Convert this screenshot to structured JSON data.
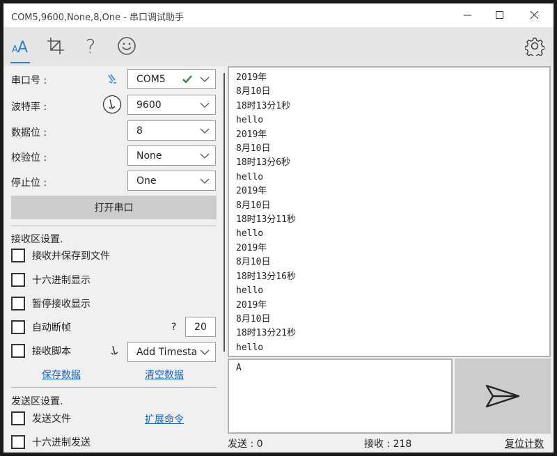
{
  "window": {
    "title": "COM5,9600,None,8,One - 串口调试助手",
    "minimize": "—",
    "maximize": "☐",
    "close": "✕"
  },
  "toolbar": {
    "font_icon": "AA",
    "crop_icon": "crop-icon",
    "help_icon": "?",
    "emoji_icon": "smiley-icon",
    "settings_icon": "gear-icon"
  },
  "serial": {
    "port_label": "串口号 :",
    "port_value": "COM5",
    "baud_label": "波特率 :",
    "baud_value": "9600",
    "databits_label": "数据位 :",
    "databits_value": "8",
    "parity_label": "校验位 :",
    "parity_value": "None",
    "stopbits_label": "停止位 :",
    "stopbits_value": "One",
    "open_button": "打开串口"
  },
  "receive_settings": {
    "title": "接收区设置.",
    "save_to_file": "接收并保存到文件",
    "hex_display": "十六进制显示",
    "pause_display": "暂停接收显示",
    "auto_frame": "自动断帧",
    "auto_frame_help": "?",
    "auto_frame_value": "20",
    "script": "接收脚本",
    "script_value": "Add Timesta",
    "save_data": "保存数据",
    "clear_data": "清空数据"
  },
  "send_settings": {
    "title": "发送区设置.",
    "send_file": "发送文件",
    "extend_cmd": "扩展命令",
    "hex_send": "十六进制发送"
  },
  "receive_lines": [
    "2019年",
    "8月10日",
    "18时13分1秒",
    "hello",
    "2019年",
    "8月10日",
    "18时13分6秒",
    "hello",
    "2019年",
    "8月10日",
    "18时13分11秒",
    "hello",
    "2019年",
    "8月10日",
    "18时13分16秒",
    "hello",
    "2019年",
    "8月10日",
    "18时13分21秒",
    "hello"
  ],
  "send_text": "A",
  "status": {
    "sent": "发送 : 0",
    "received": "接收 : 218",
    "reset": "复位计数"
  },
  "colors": {
    "accent": "#2b7cd3",
    "check": "#2e8b3a",
    "link": "#1565c0"
  }
}
